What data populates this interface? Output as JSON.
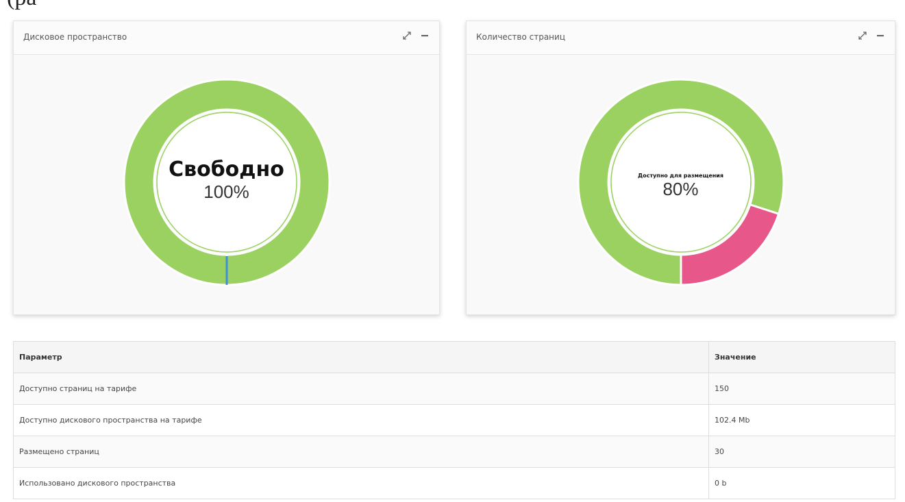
{
  "top_partial_text": "(pa",
  "panels": {
    "disk": {
      "title": "Дисковое пространство",
      "center_label": "Свободно",
      "center_value": "100%",
      "colors": {
        "free": "#9bd160",
        "used": "#3d8fd6"
      }
    },
    "pages": {
      "title": "Количество страниц",
      "center_label": "Доступно для размещения",
      "center_value": "80%",
      "colors": {
        "available": "#9bd160",
        "placed": "#e8578a"
      }
    },
    "tools": {
      "expand_icon": "expand-icon",
      "collapse_icon": "minus-icon"
    }
  },
  "chart_data": [
    {
      "type": "pie",
      "title": "Дисковое пространство",
      "slices": [
        {
          "label": "Свободно",
          "value": 100
        },
        {
          "label": "",
          "value": 0
        }
      ]
    },
    {
      "type": "pie",
      "title": "Количество страниц",
      "slices": [
        {
          "label": "Доступно для размещения",
          "value": 80
        },
        {
          "label": "",
          "value": 20
        }
      ]
    }
  ],
  "table": {
    "headers": {
      "param": "Параметр",
      "value": "Значение"
    },
    "rows": [
      {
        "param": "Доступно страниц на тарифе",
        "value": "150"
      },
      {
        "param": "Доступно дискового пространства на тарифе",
        "value": "102.4 Mb"
      },
      {
        "param": "Размещено страниц",
        "value": "30"
      },
      {
        "param": "Использовано дискового пространства",
        "value": "0 b"
      }
    ]
  }
}
